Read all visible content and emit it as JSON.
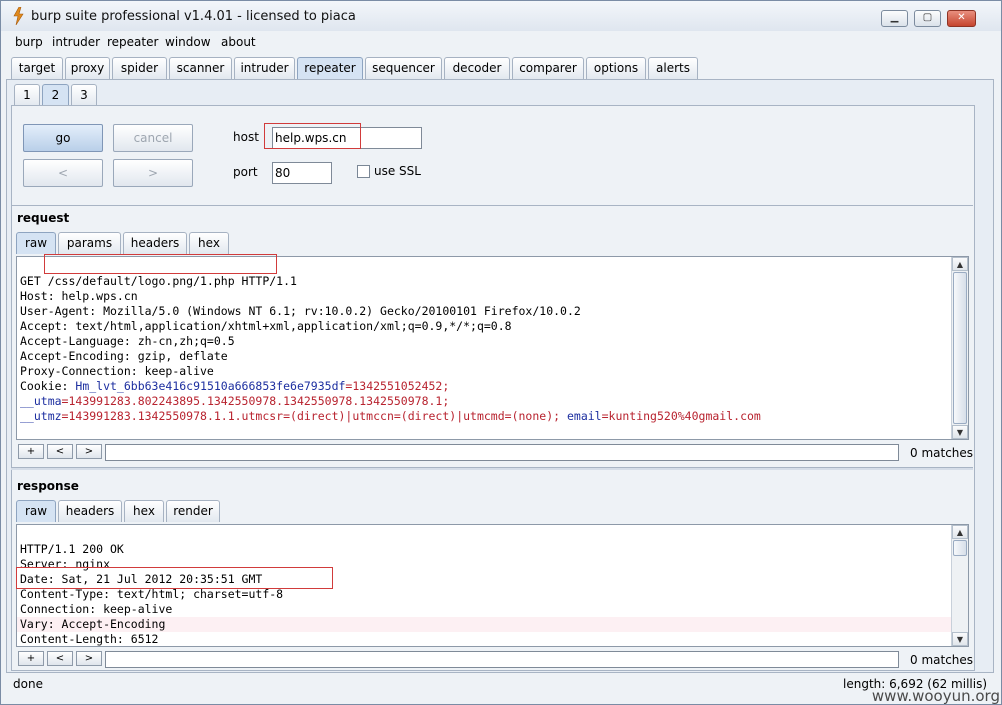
{
  "window": {
    "title": "burp suite professional v1.4.01 - licensed to piaca",
    "minimize": "▁",
    "maximize": "▢",
    "close": "✕"
  },
  "menu": [
    "burp",
    "intruder",
    "repeater",
    "window",
    "about"
  ],
  "main_tabs": [
    "target",
    "proxy",
    "spider",
    "scanner",
    "intruder",
    "repeater",
    "sequencer",
    "decoder",
    "comparer",
    "options",
    "alerts"
  ],
  "main_tab_selected": "repeater",
  "sub_tabs": [
    "1",
    "2",
    "3"
  ],
  "sub_tab_selected": "2",
  "controls": {
    "go": "go",
    "cancel": "cancel",
    "back": "<",
    "forward": ">",
    "host_label": "host",
    "host_value": "help.wps.cn",
    "port_label": "port",
    "port_value": "80",
    "ssl_label": "use SSL"
  },
  "request": {
    "title": "request",
    "tabs": [
      "raw",
      "params",
      "headers",
      "hex"
    ],
    "selected": "raw",
    "lines": [
      "GET /css/default/logo.png/1.php HTTP/1.1",
      "Host: help.wps.cn",
      "User-Agent: Mozilla/5.0 (Windows NT 6.1; rv:10.0.2) Gecko/20100101 Firefox/10.0.2",
      "Accept: text/html,application/xhtml+xml,application/xml;q=0.9,*/*;q=0.8",
      "Accept-Language: zh-cn,zh;q=0.5",
      "Accept-Encoding: gzip, deflate",
      "Proxy-Connection: keep-alive"
    ],
    "cookie_label": "Cookie: ",
    "cookie1_name": "Hm_lvt_6bb63e416c91510a666853fe6e7935df",
    "cookie1_value": "=1342551052452;",
    "cookie2_name": "__utma",
    "cookie2_value": "=143991283.802243895.1342550978.1342550978.1342550978.1;",
    "cookie3_name": "__utmz",
    "cookie3_value": "=143991283.1342550978.1.1.utmcsr=(direct)|utmccn=(direct)|utmcmd=(none);",
    "cookie4_name": " email",
    "cookie4_value": "=kunting520%40gmail.com",
    "search": {
      "plus": "+",
      "prev": "<",
      "next": ">",
      "matches": "0 matches"
    }
  },
  "response": {
    "title": "response",
    "tabs": [
      "raw",
      "headers",
      "hex",
      "render"
    ],
    "selected": "raw",
    "lines": [
      "HTTP/1.1 200 OK",
      "Server: nginx",
      "Date: Sat, 21 Jul 2012 20:35:51 GMT",
      "Content-Type: text/html; charset=utf-8",
      "Connection: keep-alive",
      "Vary: Accept-Encoding",
      "Content-Length: 6512"
    ],
    "search": {
      "plus": "+",
      "prev": "<",
      "next": ">",
      "matches": "0 matches"
    }
  },
  "status": {
    "left": "done",
    "right": "length: 6,692 (62 millis)"
  },
  "watermark": "www.wooyun.org",
  "colors": {
    "highlight_box": "#d13b3b",
    "cookie_name": "#1d2fa0",
    "cookie_value": "#b8232f"
  }
}
